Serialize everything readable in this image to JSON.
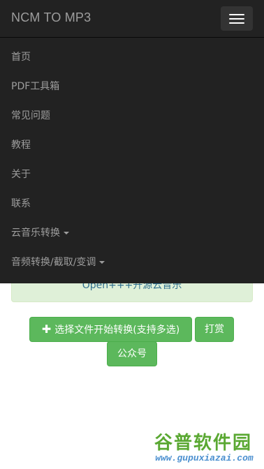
{
  "navbar": {
    "brand": "NCM TO MP3",
    "toggle_icon": "hamburger-menu-icon"
  },
  "menu": {
    "items": [
      {
        "label": "首页"
      },
      {
        "label": "PDF工具箱"
      },
      {
        "label": "常见问题"
      },
      {
        "label": "教程"
      },
      {
        "label": "关于"
      },
      {
        "label": "联系"
      },
      {
        "label": "云音乐转换",
        "dropdown": true
      },
      {
        "label": "音频转换/截取/变调",
        "dropdown": true
      }
    ]
  },
  "notice": {
    "text": "Open+++开源云音乐"
  },
  "actions": {
    "select_files_label": "选择文件开始转换(支持多选)",
    "tip_label": "打赏",
    "wechat_label": "公众号"
  },
  "watermark": {
    "logo_text": "谷普软件园",
    "url": "www.gupuxiazai.com"
  },
  "colors": {
    "navbar_bg": "#222222",
    "nav_text": "#9d9d9d",
    "button_green": "#5cb85c",
    "alert_bg": "#dff0d8",
    "alert_text": "#31708f"
  }
}
